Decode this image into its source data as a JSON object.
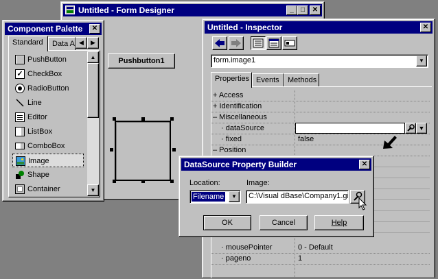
{
  "form_designer": {
    "title": "Untitled - Form Designer",
    "pushbutton_label": "Pushbutton1"
  },
  "palette": {
    "title": "Component Palette",
    "tabs": [
      "Standard",
      "Data A"
    ],
    "items": [
      "PushButton",
      "CheckBox",
      "RadioButton",
      "Line",
      "Editor",
      "ListBox",
      "ComboBox",
      "Image",
      "Shape",
      "Container"
    ],
    "selected_index": 7
  },
  "inspector": {
    "title": "Untitled - Inspector",
    "object_value": "form.image1",
    "tabs": [
      "Properties",
      "Events",
      "Methods"
    ],
    "rows": [
      {
        "label": "+ Access",
        "value": ""
      },
      {
        "label": "+ Identification",
        "value": ""
      },
      {
        "label": "– Miscellaneous",
        "value": ""
      },
      {
        "label": "· dataSource",
        "value": ""
      },
      {
        "label": "· fixed",
        "value": "false"
      },
      {
        "label": "– Position",
        "value": ""
      }
    ],
    "bottom_rows": [
      {
        "label": "· mousePointer",
        "value": "0 - Default"
      },
      {
        "label": "· pageno",
        "value": "1"
      }
    ]
  },
  "dialog": {
    "title": "DataSource Property Builder",
    "location_label": "Location:",
    "location_value": "Filename",
    "image_label": "Image:",
    "image_value": "C:\\Visual dBase\\Company1.gi",
    "ok_label": "OK",
    "cancel_label": "Cancel",
    "help_label": "Help"
  }
}
